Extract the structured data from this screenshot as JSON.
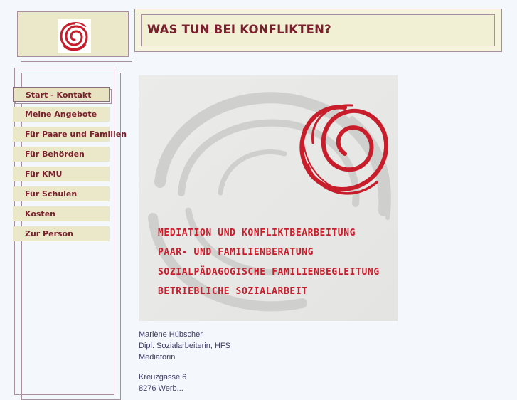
{
  "header": {
    "title": "WAS TUN BEI KONFLIKTEN?",
    "logo_icon": "red-spiral-logo-icon"
  },
  "nav": {
    "items": [
      {
        "label": "Start - Kontakt",
        "active": true
      },
      {
        "label": "Meine Angebote"
      },
      {
        "label": "Für Paare und Familien"
      },
      {
        "label": "Für Behörden"
      },
      {
        "label": "Für KMU"
      },
      {
        "label": "Für Schulen"
      },
      {
        "label": "Kosten"
      },
      {
        "label": "Zur Person"
      }
    ]
  },
  "hero": {
    "lines": [
      "MEDIATION UND KONFLIKTBEARBEITUNG",
      "PAAR- UND FAMILIENBERATUNG",
      "SOZIALPÄDAGOGISCHE FAMILIENBEGLEITUNG",
      "BETRIEBLICHE SOZIALARBEIT"
    ]
  },
  "contact": {
    "name": "Marlène Hübscher",
    "title": "Dipl. Sozialarbeiterin, HFS",
    "role": "Mediatorin",
    "street": "Kreuzgasse 6",
    "city": "8276 Werb..."
  },
  "colors": {
    "accent": "#7a1f2c",
    "box_fill": "#ebe8c9",
    "logo_red": "#c81e2c",
    "background": "#f4f7fc",
    "text": "#3f3d63"
  }
}
